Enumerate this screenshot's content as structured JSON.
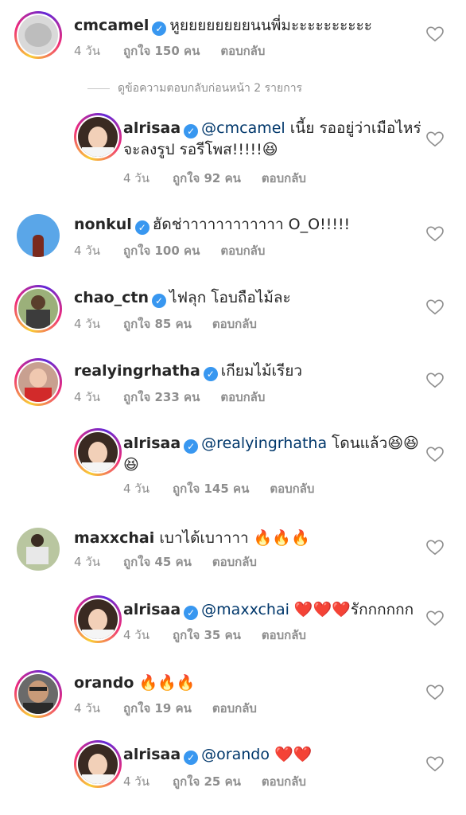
{
  "view_previous": "ดูข้อความตอบกลับก่อนหน้า 2 รายการ",
  "comments": [
    {
      "user": "cmcamel",
      "text": "หูยยยยยยยยนนพี่มะะะะะะะะะะ",
      "time": "4 วัน",
      "likes": "ถูกใจ 150 คน",
      "reply": "ตอบกลับ"
    },
    {
      "user": "alrisaa",
      "mention": "@cmcamel",
      "text": " เนี้ย รออยู่ว่าเมือไหร่",
      "text2": "จะลงรูป รอรีโพส!!!!!😆",
      "time": "4 วัน",
      "likes": "ถูกใจ 92 คน",
      "reply": "ตอบกลับ"
    },
    {
      "user": "nonkul",
      "text": "ฮัดช่าาาาาาาาาาาา O_O!!!!!",
      "time": "4 วัน",
      "likes": "ถูกใจ 100 คน",
      "reply": "ตอบกลับ"
    },
    {
      "user": "chao_ctn",
      "text": "ไฟลุก โอบถือไม้ละ",
      "time": "4 วัน",
      "likes": "ถูกใจ 85 คน",
      "reply": "ตอบกลับ"
    },
    {
      "user": "realyingrhatha",
      "text": "เกียมไม้เรียว",
      "time": "4 วัน",
      "likes": "ถูกใจ 233 คน",
      "reply": "ตอบกลับ"
    },
    {
      "user": "alrisaa",
      "mention": "@realyingrhatha",
      "text": " โดนแล้ว😆😆",
      "text2": "😆",
      "time": "4 วัน",
      "likes": "ถูกใจ 145 คน",
      "reply": "ตอบกลับ"
    },
    {
      "user": "maxxchai",
      "text": "เบาได้เบาาาา 🔥🔥🔥",
      "time": "4 วัน",
      "likes": "ถูกใจ 45 คน",
      "reply": "ตอบกลับ"
    },
    {
      "user": "alrisaa",
      "mention": "@maxxchai",
      "text": " ❤️❤️❤️รักกกกกก",
      "time": "4 วัน",
      "likes": "ถูกใจ 35 คน",
      "reply": "ตอบกลับ"
    },
    {
      "user": "orando",
      "text": "🔥🔥🔥",
      "time": "4 วัน",
      "likes": "ถูกใจ 19 คน",
      "reply": "ตอบกลับ"
    },
    {
      "user": "alrisaa",
      "mention": "@orando",
      "text": " ❤️❤️",
      "time": "4 วัน",
      "likes": "ถูกใจ 25 คน",
      "reply": "ตอบกลับ"
    }
  ]
}
